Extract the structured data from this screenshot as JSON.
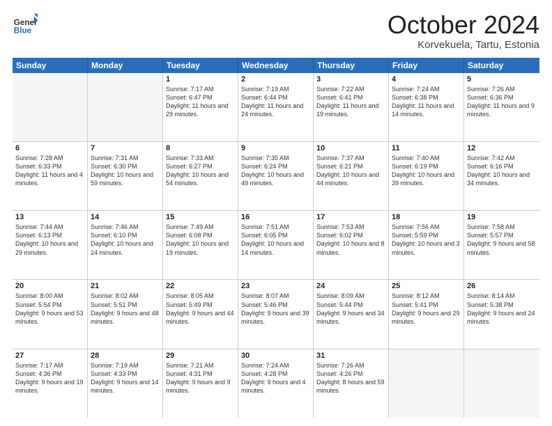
{
  "logo": {
    "general": "General",
    "blue": "Blue"
  },
  "title": "October 2024",
  "subtitle": "Korvekuela, Tartu, Estonia",
  "days": [
    "Sunday",
    "Monday",
    "Tuesday",
    "Wednesday",
    "Thursday",
    "Friday",
    "Saturday"
  ],
  "weeks": [
    [
      {
        "day": "",
        "empty": true
      },
      {
        "day": "",
        "empty": true
      },
      {
        "day": "1",
        "sunrise": "Sunrise: 7:17 AM",
        "sunset": "Sunset: 6:47 PM",
        "daylight": "Daylight: 11 hours and 29 minutes."
      },
      {
        "day": "2",
        "sunrise": "Sunrise: 7:19 AM",
        "sunset": "Sunset: 6:44 PM",
        "daylight": "Daylight: 11 hours and 24 minutes."
      },
      {
        "day": "3",
        "sunrise": "Sunrise: 7:22 AM",
        "sunset": "Sunset: 6:41 PM",
        "daylight": "Daylight: 11 hours and 19 minutes."
      },
      {
        "day": "4",
        "sunrise": "Sunrise: 7:24 AM",
        "sunset": "Sunset: 6:38 PM",
        "daylight": "Daylight: 11 hours and 14 minutes."
      },
      {
        "day": "5",
        "sunrise": "Sunrise: 7:26 AM",
        "sunset": "Sunset: 6:36 PM",
        "daylight": "Daylight: 11 hours and 9 minutes."
      }
    ],
    [
      {
        "day": "6",
        "sunrise": "Sunrise: 7:28 AM",
        "sunset": "Sunset: 6:33 PM",
        "daylight": "Daylight: 11 hours and 4 minutes."
      },
      {
        "day": "7",
        "sunrise": "Sunrise: 7:31 AM",
        "sunset": "Sunset: 6:30 PM",
        "daylight": "Daylight: 10 hours and 59 minutes."
      },
      {
        "day": "8",
        "sunrise": "Sunrise: 7:33 AM",
        "sunset": "Sunset: 6:27 PM",
        "daylight": "Daylight: 10 hours and 54 minutes."
      },
      {
        "day": "9",
        "sunrise": "Sunrise: 7:35 AM",
        "sunset": "Sunset: 6:24 PM",
        "daylight": "Daylight: 10 hours and 49 minutes."
      },
      {
        "day": "10",
        "sunrise": "Sunrise: 7:37 AM",
        "sunset": "Sunset: 6:21 PM",
        "daylight": "Daylight: 10 hours and 44 minutes."
      },
      {
        "day": "11",
        "sunrise": "Sunrise: 7:40 AM",
        "sunset": "Sunset: 6:19 PM",
        "daylight": "Daylight: 10 hours and 39 minutes."
      },
      {
        "day": "12",
        "sunrise": "Sunrise: 7:42 AM",
        "sunset": "Sunset: 6:16 PM",
        "daylight": "Daylight: 10 hours and 34 minutes."
      }
    ],
    [
      {
        "day": "13",
        "sunrise": "Sunrise: 7:44 AM",
        "sunset": "Sunset: 6:13 PM",
        "daylight": "Daylight: 10 hours and 29 minutes."
      },
      {
        "day": "14",
        "sunrise": "Sunrise: 7:46 AM",
        "sunset": "Sunset: 6:10 PM",
        "daylight": "Daylight: 10 hours and 24 minutes."
      },
      {
        "day": "15",
        "sunrise": "Sunrise: 7:49 AM",
        "sunset": "Sunset: 6:08 PM",
        "daylight": "Daylight: 10 hours and 19 minutes."
      },
      {
        "day": "16",
        "sunrise": "Sunrise: 7:51 AM",
        "sunset": "Sunset: 6:05 PM",
        "daylight": "Daylight: 10 hours and 14 minutes."
      },
      {
        "day": "17",
        "sunrise": "Sunrise: 7:53 AM",
        "sunset": "Sunset: 6:02 PM",
        "daylight": "Daylight: 10 hours and 8 minutes."
      },
      {
        "day": "18",
        "sunrise": "Sunrise: 7:56 AM",
        "sunset": "Sunset: 5:59 PM",
        "daylight": "Daylight: 10 hours and 3 minutes."
      },
      {
        "day": "19",
        "sunrise": "Sunrise: 7:58 AM",
        "sunset": "Sunset: 5:57 PM",
        "daylight": "Daylight: 9 hours and 58 minutes."
      }
    ],
    [
      {
        "day": "20",
        "sunrise": "Sunrise: 8:00 AM",
        "sunset": "Sunset: 5:54 PM",
        "daylight": "Daylight: 9 hours and 53 minutes."
      },
      {
        "day": "21",
        "sunrise": "Sunrise: 8:02 AM",
        "sunset": "Sunset: 5:51 PM",
        "daylight": "Daylight: 9 hours and 48 minutes."
      },
      {
        "day": "22",
        "sunrise": "Sunrise: 8:05 AM",
        "sunset": "Sunset: 5:49 PM",
        "daylight": "Daylight: 9 hours and 44 minutes."
      },
      {
        "day": "23",
        "sunrise": "Sunrise: 8:07 AM",
        "sunset": "Sunset: 5:46 PM",
        "daylight": "Daylight: 9 hours and 39 minutes."
      },
      {
        "day": "24",
        "sunrise": "Sunrise: 8:09 AM",
        "sunset": "Sunset: 5:44 PM",
        "daylight": "Daylight: 9 hours and 34 minutes."
      },
      {
        "day": "25",
        "sunrise": "Sunrise: 8:12 AM",
        "sunset": "Sunset: 5:41 PM",
        "daylight": "Daylight: 9 hours and 29 minutes."
      },
      {
        "day": "26",
        "sunrise": "Sunrise: 8:14 AM",
        "sunset": "Sunset: 5:38 PM",
        "daylight": "Daylight: 9 hours and 24 minutes."
      }
    ],
    [
      {
        "day": "27",
        "sunrise": "Sunrise: 7:17 AM",
        "sunset": "Sunset: 4:36 PM",
        "daylight": "Daylight: 9 hours and 19 minutes."
      },
      {
        "day": "28",
        "sunrise": "Sunrise: 7:19 AM",
        "sunset": "Sunset: 4:33 PM",
        "daylight": "Daylight: 9 hours and 14 minutes."
      },
      {
        "day": "29",
        "sunrise": "Sunrise: 7:21 AM",
        "sunset": "Sunset: 4:31 PM",
        "daylight": "Daylight: 9 hours and 9 minutes."
      },
      {
        "day": "30",
        "sunrise": "Sunrise: 7:24 AM",
        "sunset": "Sunset: 4:28 PM",
        "daylight": "Daylight: 9 hours and 4 minutes."
      },
      {
        "day": "31",
        "sunrise": "Sunrise: 7:26 AM",
        "sunset": "Sunset: 4:26 PM",
        "daylight": "Daylight: 8 hours and 59 minutes."
      },
      {
        "day": "",
        "empty": true
      },
      {
        "day": "",
        "empty": true
      }
    ]
  ]
}
